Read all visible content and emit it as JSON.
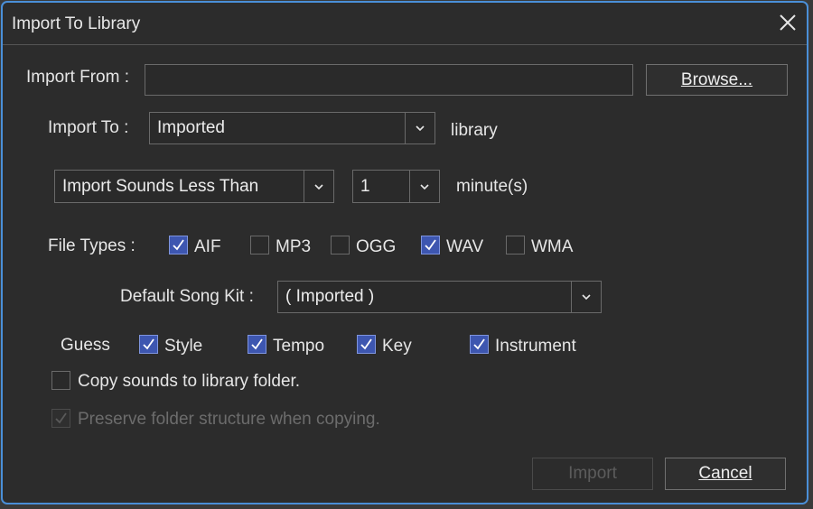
{
  "dialog": {
    "title": "Import To Library",
    "close_icon": "close-icon"
  },
  "import_from": {
    "label": "Import From :",
    "value": "",
    "browse_label": "Browse..."
  },
  "import_to": {
    "label": "Import To :",
    "selected": "Imported",
    "suffix": "library"
  },
  "sound_filter": {
    "mode_selected": "Import Sounds Less Than",
    "amount_selected": "1",
    "unit": "minute(s)"
  },
  "file_types": {
    "label": "File Types :",
    "items": [
      {
        "label": "AIF",
        "checked": true
      },
      {
        "label": "MP3",
        "checked": false
      },
      {
        "label": "OGG",
        "checked": false
      },
      {
        "label": "WAV",
        "checked": true
      },
      {
        "label": "WMA",
        "checked": false
      }
    ]
  },
  "song_kit": {
    "label": "Default Song Kit :",
    "selected": "( Imported )"
  },
  "guess": {
    "label": "Guess",
    "items": [
      {
        "label": "Style",
        "checked": true
      },
      {
        "label": "Tempo",
        "checked": true
      },
      {
        "label": "Key",
        "checked": true
      },
      {
        "label": "Instrument",
        "checked": true
      }
    ]
  },
  "options": {
    "copy_label": "Copy sounds to library folder.",
    "copy_checked": false,
    "preserve_label": "Preserve folder structure when copying.",
    "preserve_checked": true,
    "preserve_enabled": false
  },
  "footer": {
    "import_label": "Import",
    "import_enabled": false,
    "cancel_label": "Cancel"
  },
  "colors": {
    "accent_border": "#4a8fd8",
    "checkbox_fill": "#3d56b0",
    "background": "#2c2c2c"
  }
}
